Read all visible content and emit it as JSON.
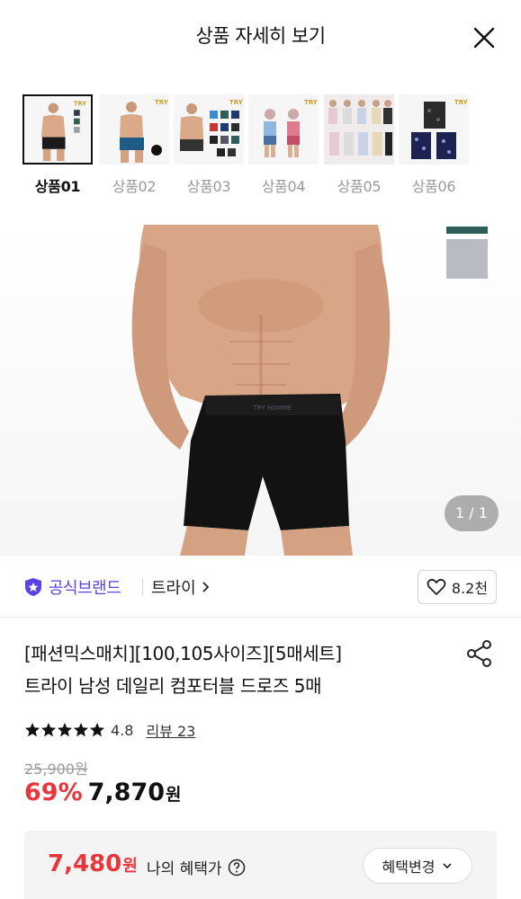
{
  "header": {
    "title": "상품 자세히 보기",
    "close_icon": "close-icon"
  },
  "thumbnails": [
    {
      "label": "상품01",
      "brand_mark": "TRY",
      "active": true
    },
    {
      "label": "상품02",
      "brand_mark": "TRY",
      "active": false
    },
    {
      "label": "상품03",
      "brand_mark": "TRY",
      "active": false
    },
    {
      "label": "상품04",
      "brand_mark": "TRY",
      "active": false
    },
    {
      "label": "상품05",
      "brand_mark": "",
      "active": false
    },
    {
      "label": "상품06",
      "brand_mark": "TRY",
      "active": false
    }
  ],
  "hero": {
    "counter": "1 / 1",
    "waistband_text": "TRY HOMME"
  },
  "brand": {
    "badge_label": "공식브랜드",
    "brand_name": "트라이",
    "like_count": "8.2천"
  },
  "product": {
    "title_line1": "[패션믹스매치][100,105사이즈][5매세트]",
    "title_line2": "트라이 남성 데일리 컴포터블 드로즈 5매"
  },
  "rating": {
    "value": "4.8",
    "review_label": "리뷰 23",
    "stars": 5
  },
  "price": {
    "original": "25,900원",
    "discount": "69%",
    "sale": "7,870",
    "unit": "원"
  },
  "benefit": {
    "amount": "7,480",
    "unit": "원",
    "label": "나의 혜택가",
    "change_button": "혜택변경"
  },
  "colors": {
    "accent_red": "#e8363c",
    "brand_purple": "#5b43e3",
    "swatch_green": "#2f5d58",
    "swatch_gray": "#b8bcc2"
  }
}
